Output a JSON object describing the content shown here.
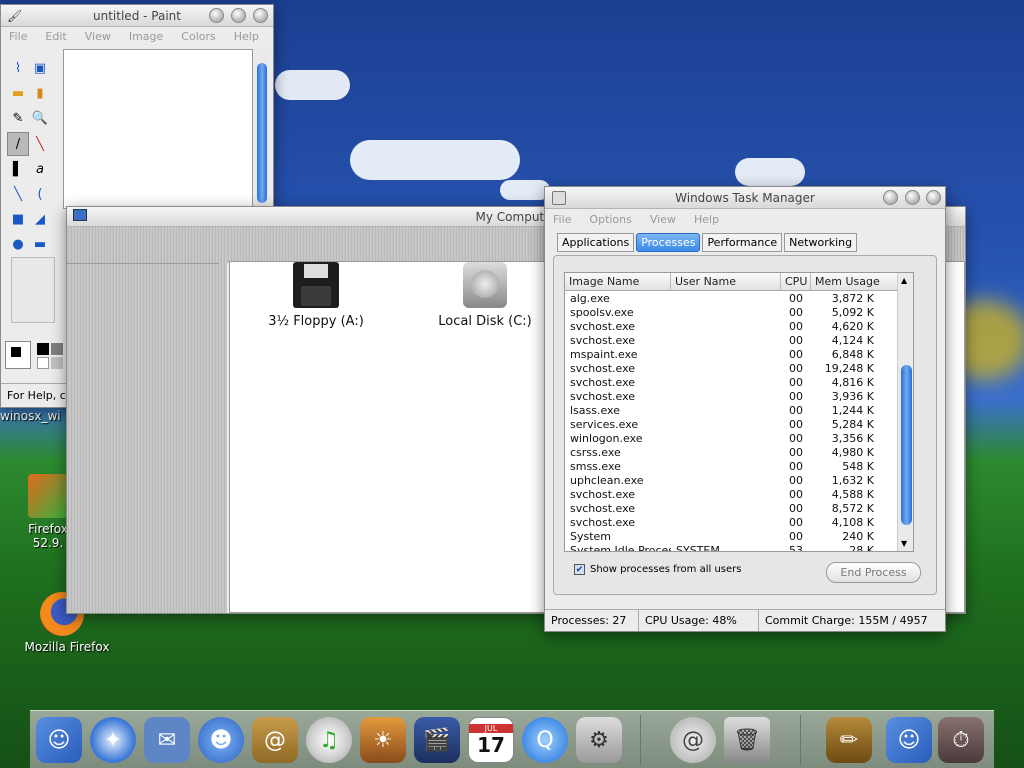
{
  "desktop": {
    "icons": [
      {
        "label": "winosx_wi"
      },
      {
        "label": "Firefox\n52.9."
      },
      {
        "label": "Mozilla Firefox"
      }
    ]
  },
  "paint": {
    "title": "untitled - Paint",
    "menu": [
      "File",
      "Edit",
      "View",
      "Image",
      "Colors",
      "Help"
    ],
    "status": "For Help, cl"
  },
  "my_computer": {
    "title": "My Computer",
    "drives": [
      {
        "label": "3½ Floppy (A:)",
        "icon": "floppy-icon"
      },
      {
        "label": "Local Disk (C:)",
        "icon": "hard-disk-icon"
      }
    ]
  },
  "task_manager": {
    "title": "Windows Task Manager",
    "menu": [
      "File",
      "Options",
      "View",
      "Help"
    ],
    "tabs": [
      "Applications",
      "Processes",
      "Performance",
      "Networking"
    ],
    "active_tab": "Processes",
    "columns": [
      "Image Name",
      "User Name",
      "CPU",
      "Mem Usage"
    ],
    "rows": [
      {
        "image": "alg.exe",
        "user": "",
        "cpu": "00",
        "mem": "3,872 K"
      },
      {
        "image": "spoolsv.exe",
        "user": "",
        "cpu": "00",
        "mem": "5,092 K"
      },
      {
        "image": "svchost.exe",
        "user": "",
        "cpu": "00",
        "mem": "4,620 K"
      },
      {
        "image": "svchost.exe",
        "user": "",
        "cpu": "00",
        "mem": "4,124 K"
      },
      {
        "image": "mspaint.exe",
        "user": "",
        "cpu": "00",
        "mem": "6,848 K"
      },
      {
        "image": "svchost.exe",
        "user": "",
        "cpu": "00",
        "mem": "19,248 K"
      },
      {
        "image": "svchost.exe",
        "user": "",
        "cpu": "00",
        "mem": "4,816 K"
      },
      {
        "image": "svchost.exe",
        "user": "",
        "cpu": "00",
        "mem": "3,936 K"
      },
      {
        "image": "lsass.exe",
        "user": "",
        "cpu": "00",
        "mem": "1,244 K"
      },
      {
        "image": "services.exe",
        "user": "",
        "cpu": "00",
        "mem": "5,284 K"
      },
      {
        "image": "winlogon.exe",
        "user": "",
        "cpu": "00",
        "mem": "3,356 K"
      },
      {
        "image": "csrss.exe",
        "user": "",
        "cpu": "00",
        "mem": "4,980 K"
      },
      {
        "image": "smss.exe",
        "user": "",
        "cpu": "00",
        "mem": "548 K"
      },
      {
        "image": "uphclean.exe",
        "user": "",
        "cpu": "00",
        "mem": "1,632 K"
      },
      {
        "image": "svchost.exe",
        "user": "",
        "cpu": "00",
        "mem": "4,588 K"
      },
      {
        "image": "svchost.exe",
        "user": "",
        "cpu": "00",
        "mem": "8,572 K"
      },
      {
        "image": "svchost.exe",
        "user": "",
        "cpu": "00",
        "mem": "4,108 K"
      },
      {
        "image": "System",
        "user": "",
        "cpu": "00",
        "mem": "240 K"
      },
      {
        "image": "System Idle Process",
        "user": "SYSTEM",
        "cpu": "53",
        "mem": "28 K"
      }
    ],
    "show_all_label": "Show processes from all users",
    "show_all_checked": true,
    "end_process_label": "End Process",
    "status": {
      "processes": "Processes: 27",
      "cpu": "CPU Usage: 48%",
      "commit": "Commit Charge: 155M / 4957"
    }
  },
  "dock": {
    "items": [
      "finder-icon",
      "safari-icon",
      "mail-stamp-icon",
      "ichat-icon",
      "address-book-icon",
      "itunes-icon",
      "iphoto-icon",
      "imovie-icon",
      "ical-icon",
      "quicktime-icon",
      "system-preferences-icon",
      "mail-icon",
      "trash-icon",
      "pencils-icon",
      "finder-icon-2",
      "stopwatch-icon"
    ],
    "ical_day": "17",
    "ical_month": "JUL"
  }
}
